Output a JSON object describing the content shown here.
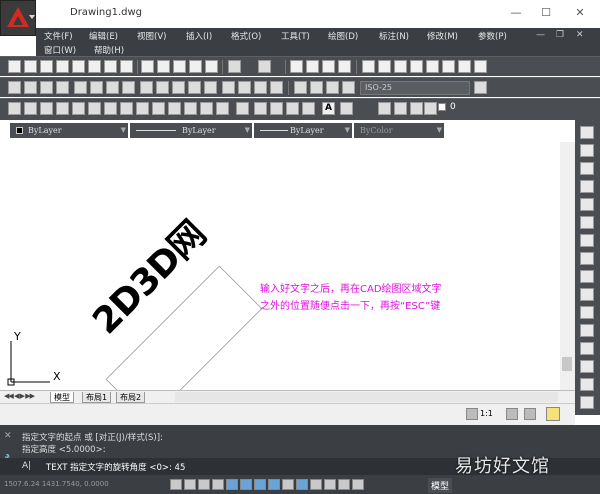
{
  "window": {
    "title": "Drawing1.dwg",
    "minimize": "—",
    "maximize": "☐",
    "close": "✕"
  },
  "menu": {
    "row1": [
      {
        "label": "文件(F)"
      },
      {
        "label": "编辑(E)"
      },
      {
        "label": "视图(V)"
      },
      {
        "label": "插入(I)"
      },
      {
        "label": "格式(O)"
      },
      {
        "label": "工具(T)"
      },
      {
        "label": "绘图(D)"
      },
      {
        "label": "标注(N)"
      },
      {
        "label": "修改(M)"
      },
      {
        "label": "参数(P)"
      }
    ],
    "row2": [
      {
        "label": "窗口(W)"
      },
      {
        "label": "帮助(H)"
      }
    ],
    "child_min": "—",
    "child_restore": "❐",
    "child_close": "✕"
  },
  "toolbar": {
    "dimstyle": "ISO-25",
    "layer_value": "0"
  },
  "props": {
    "color": "ByLayer",
    "linetype": "ByLayer",
    "lineweight": "ByLayer",
    "plotstyle": "ByColor"
  },
  "canvas": {
    "drawn_text": "2D3D网",
    "annotation_line1": "输入好文字之后，再在CAD绘图区域文字",
    "annotation_line2": "之外的位置随便点击一下，再按“ESC”键",
    "annotation_color": "#e010e0",
    "ucs_x": "X",
    "ucs_y": "Y"
  },
  "tabs": [
    {
      "label": "模型",
      "active": true
    },
    {
      "label": "布局1",
      "active": false
    },
    {
      "label": "布局2",
      "active": false
    }
  ],
  "nav_arrows": "◀◀ ◀ ▶ ▶▶",
  "annotation_scale": "1:1",
  "command": {
    "line1": "指定文字的起点 或 [对正(J)/样式(S)]:",
    "line2": "指定高度 <5.0000>:",
    "prompt_icon": "A|",
    "current": "TEXT 指定文字的旋转角度 <0>: 45"
  },
  "status": {
    "coords": "1507.6.24  1431.7540, 0.0000",
    "model_label": "模型"
  },
  "watermark": "易坊好文馆"
}
